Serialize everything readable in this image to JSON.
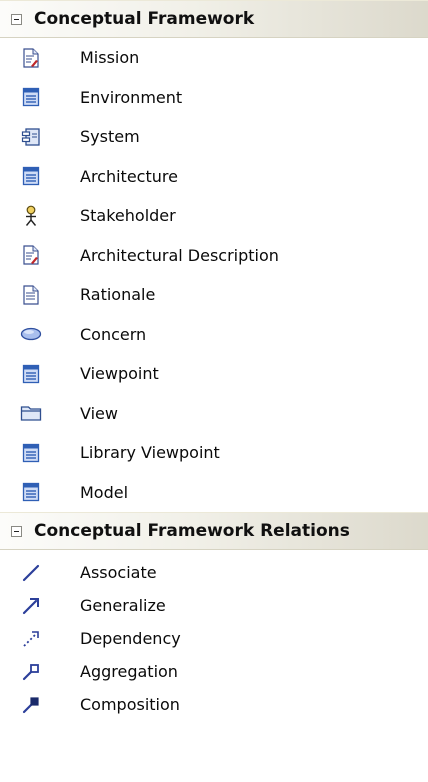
{
  "sections": [
    {
      "title": "Conceptual Framework",
      "items": [
        {
          "label": "Mission",
          "icon": "document-red-icon"
        },
        {
          "label": "Environment",
          "icon": "class-icon"
        },
        {
          "label": "System",
          "icon": "component-icon"
        },
        {
          "label": "Architecture",
          "icon": "class-icon"
        },
        {
          "label": "Stakeholder",
          "icon": "actor-icon"
        },
        {
          "label": "Architectural Description",
          "icon": "document-red-icon"
        },
        {
          "label": "Rationale",
          "icon": "document-icon"
        },
        {
          "label": "Concern",
          "icon": "ellipse-icon"
        },
        {
          "label": "Viewpoint",
          "icon": "class-icon"
        },
        {
          "label": "View",
          "icon": "folder-icon"
        },
        {
          "label": "Library Viewpoint",
          "icon": "class-icon"
        },
        {
          "label": "Model",
          "icon": "class-icon"
        }
      ]
    },
    {
      "title": "Conceptual Framework Relations",
      "items": [
        {
          "label": "Associate",
          "icon": "associate-line-icon"
        },
        {
          "label": "Generalize",
          "icon": "generalize-arrow-icon"
        },
        {
          "label": "Dependency",
          "icon": "dependency-arrow-icon"
        },
        {
          "label": "Aggregation",
          "icon": "aggregation-icon"
        },
        {
          "label": "Composition",
          "icon": "composition-icon"
        }
      ]
    }
  ],
  "colors": {
    "icon_blue": "#2f5fb5",
    "icon_red": "#c0282a",
    "header_gradient_end": "#dcd9cc"
  }
}
